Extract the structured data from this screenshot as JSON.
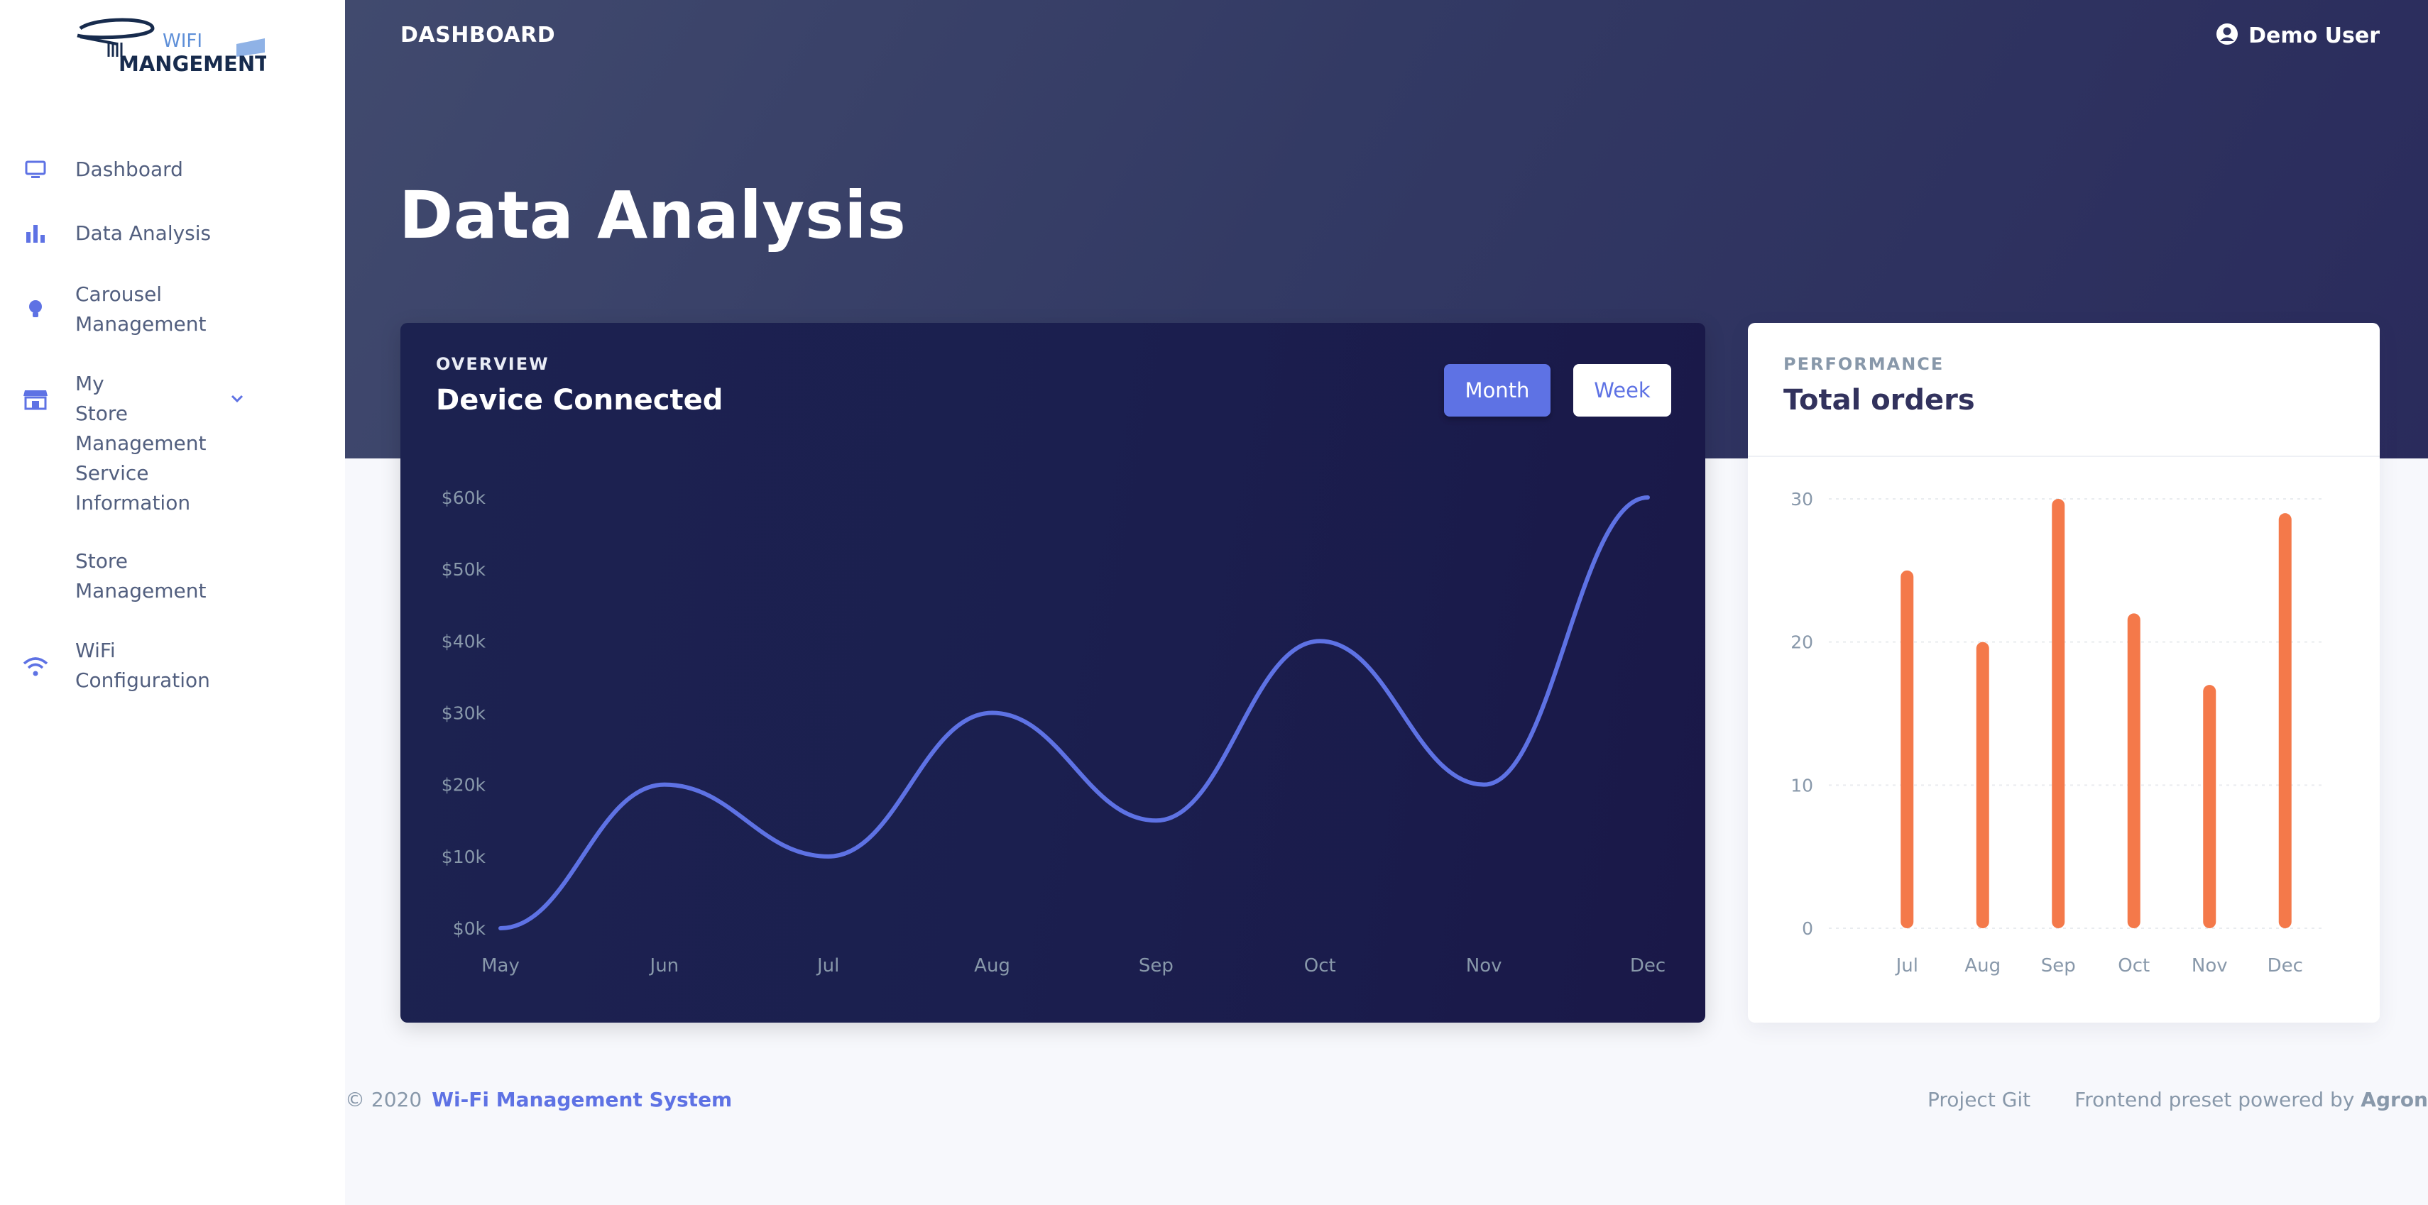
{
  "logo": {
    "text_top": "WIFI",
    "text_bottom": "MANGEMENT"
  },
  "sidebar": {
    "items": [
      {
        "label": "Dashboard",
        "icon": "monitor-icon"
      },
      {
        "label": "Data Analysis",
        "icon": "bar-chart-icon"
      },
      {
        "label": "Carousel Management",
        "icon": "bulb-icon"
      },
      {
        "label": "My Store Management",
        "icon": "store-icon",
        "expanded": true
      },
      {
        "label": "Service Information"
      },
      {
        "label": "Store Management"
      },
      {
        "label": "WiFi Configuration",
        "icon": "wifi-icon"
      }
    ]
  },
  "header": {
    "breadcrumb": "DASHBOARD",
    "user": "Demo User",
    "page_title": "Data Analysis"
  },
  "overview_card": {
    "eyebrow": "OVERVIEW",
    "title": "Device Connected",
    "btn_month": "Month",
    "btn_week": "Week"
  },
  "performance_card": {
    "eyebrow": "PERFORMANCE",
    "title": "Total orders"
  },
  "colors": {
    "primary": "#5e72e4",
    "orange": "#f4794a",
    "dark_card": "#1b1f4f"
  },
  "footer": {
    "copyright": "© 2020",
    "brand": "Wi-Fi Management System",
    "link_git": "Project Git",
    "credit_prefix": "Frontend preset powered by",
    "credit_name": "Agron"
  },
  "chart_data": [
    {
      "type": "line",
      "x": [
        "May",
        "Jun",
        "Jul",
        "Aug",
        "Sep",
        "Oct",
        "Nov",
        "Dec"
      ],
      "series": [
        {
          "values": [
            0,
            20,
            10,
            30,
            15,
            40,
            20,
            60
          ]
        }
      ],
      "y_ticks": [
        "$0k",
        "$10k",
        "$20k",
        "$30k",
        "$40k",
        "$50k",
        "$60k"
      ],
      "ylim": [
        0,
        60
      ],
      "grid": false
    },
    {
      "type": "bar",
      "categories": [
        "Jul",
        "Aug",
        "Sep",
        "Oct",
        "Nov",
        "Dec"
      ],
      "values": [
        25,
        20,
        30,
        22,
        17,
        29
      ],
      "y_ticks": [
        "0",
        "10",
        "20",
        "30"
      ],
      "ylim": [
        0,
        30
      ],
      "grid": true
    }
  ]
}
